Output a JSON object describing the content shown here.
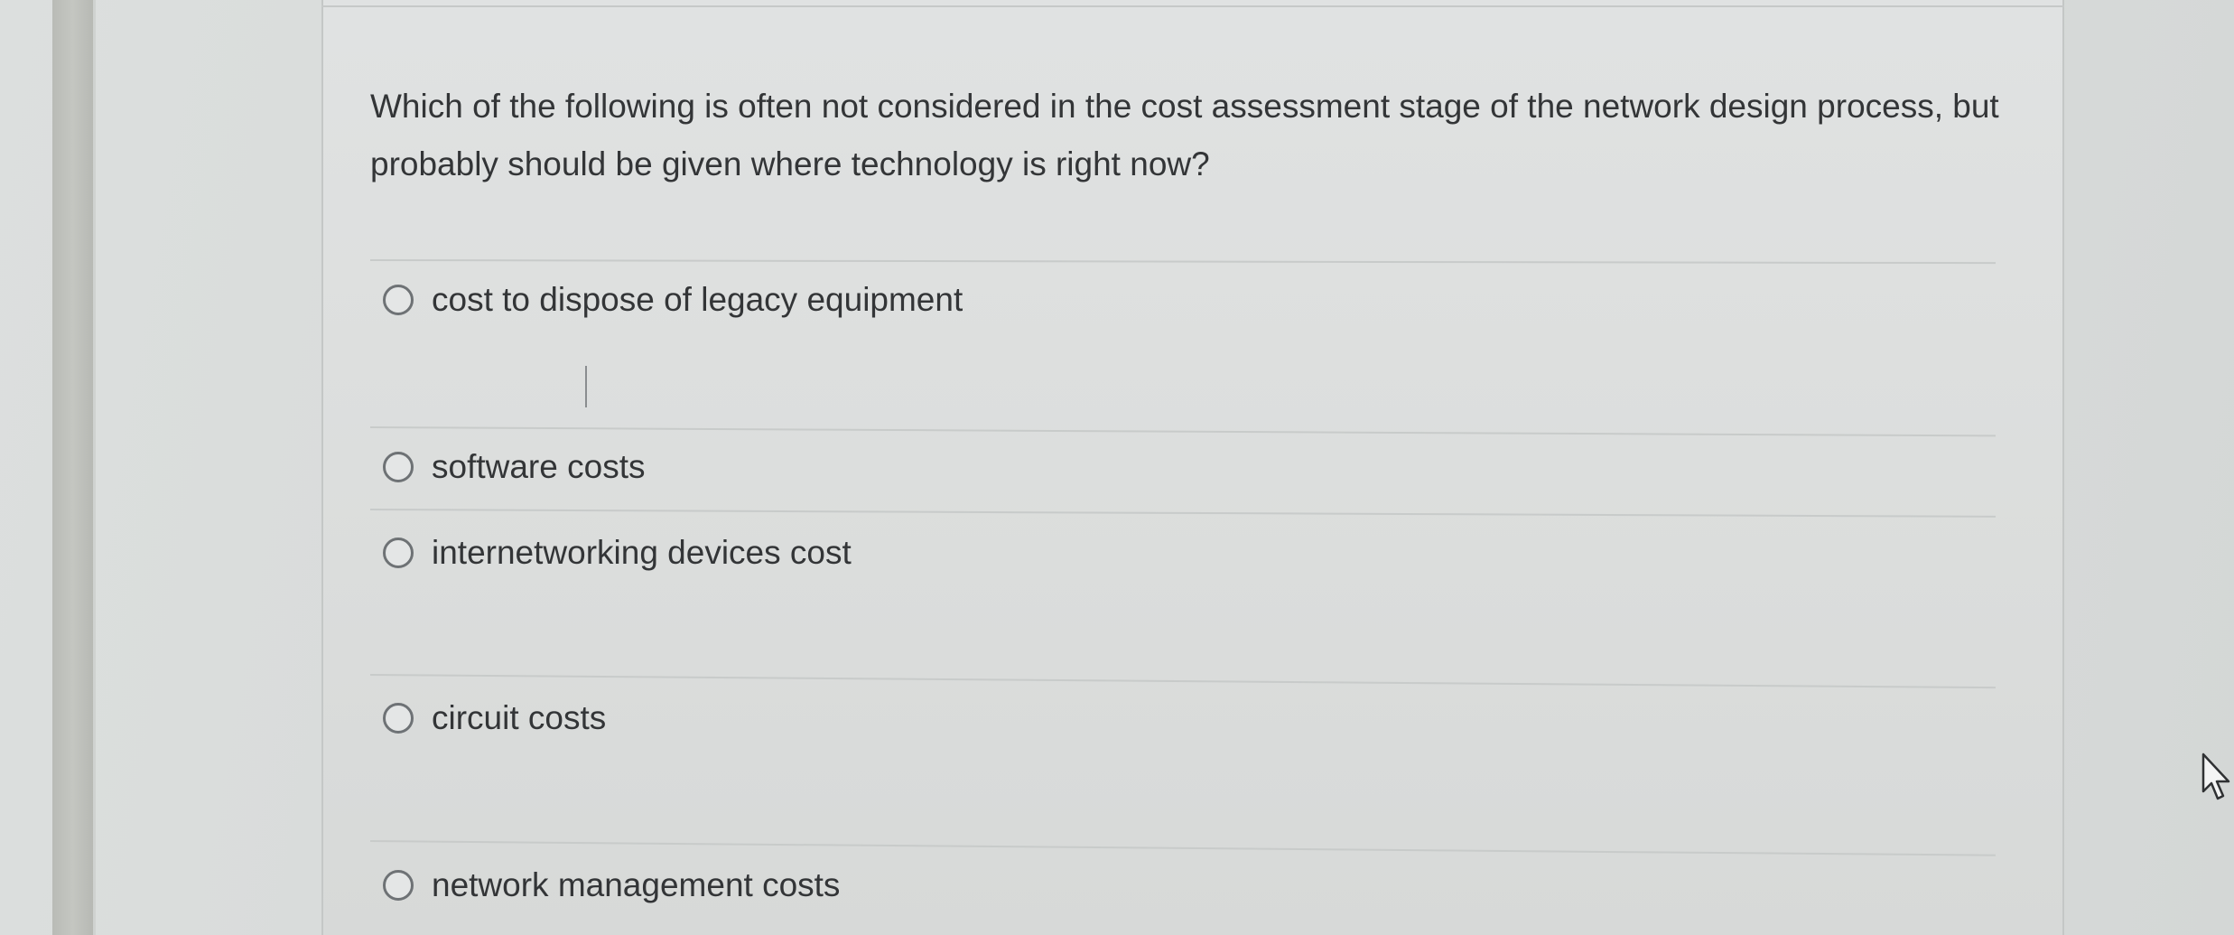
{
  "question": {
    "text": "Which of the following is often not considered in the cost assessment stage of the network design process, but probably should be given where technology is right now?"
  },
  "options": [
    {
      "label": "cost to dispose of legacy equipment"
    },
    {
      "label": "software costs"
    },
    {
      "label": "internetworking devices cost"
    },
    {
      "label": "circuit costs"
    },
    {
      "label": "network management costs"
    }
  ],
  "icons": {
    "radio": "radio-button-unselected-icon",
    "pointer": "mouse-pointer-icon"
  },
  "colors": {
    "text": "#333537",
    "radio_border": "#6e7275",
    "card_background": "#dcdedd"
  }
}
